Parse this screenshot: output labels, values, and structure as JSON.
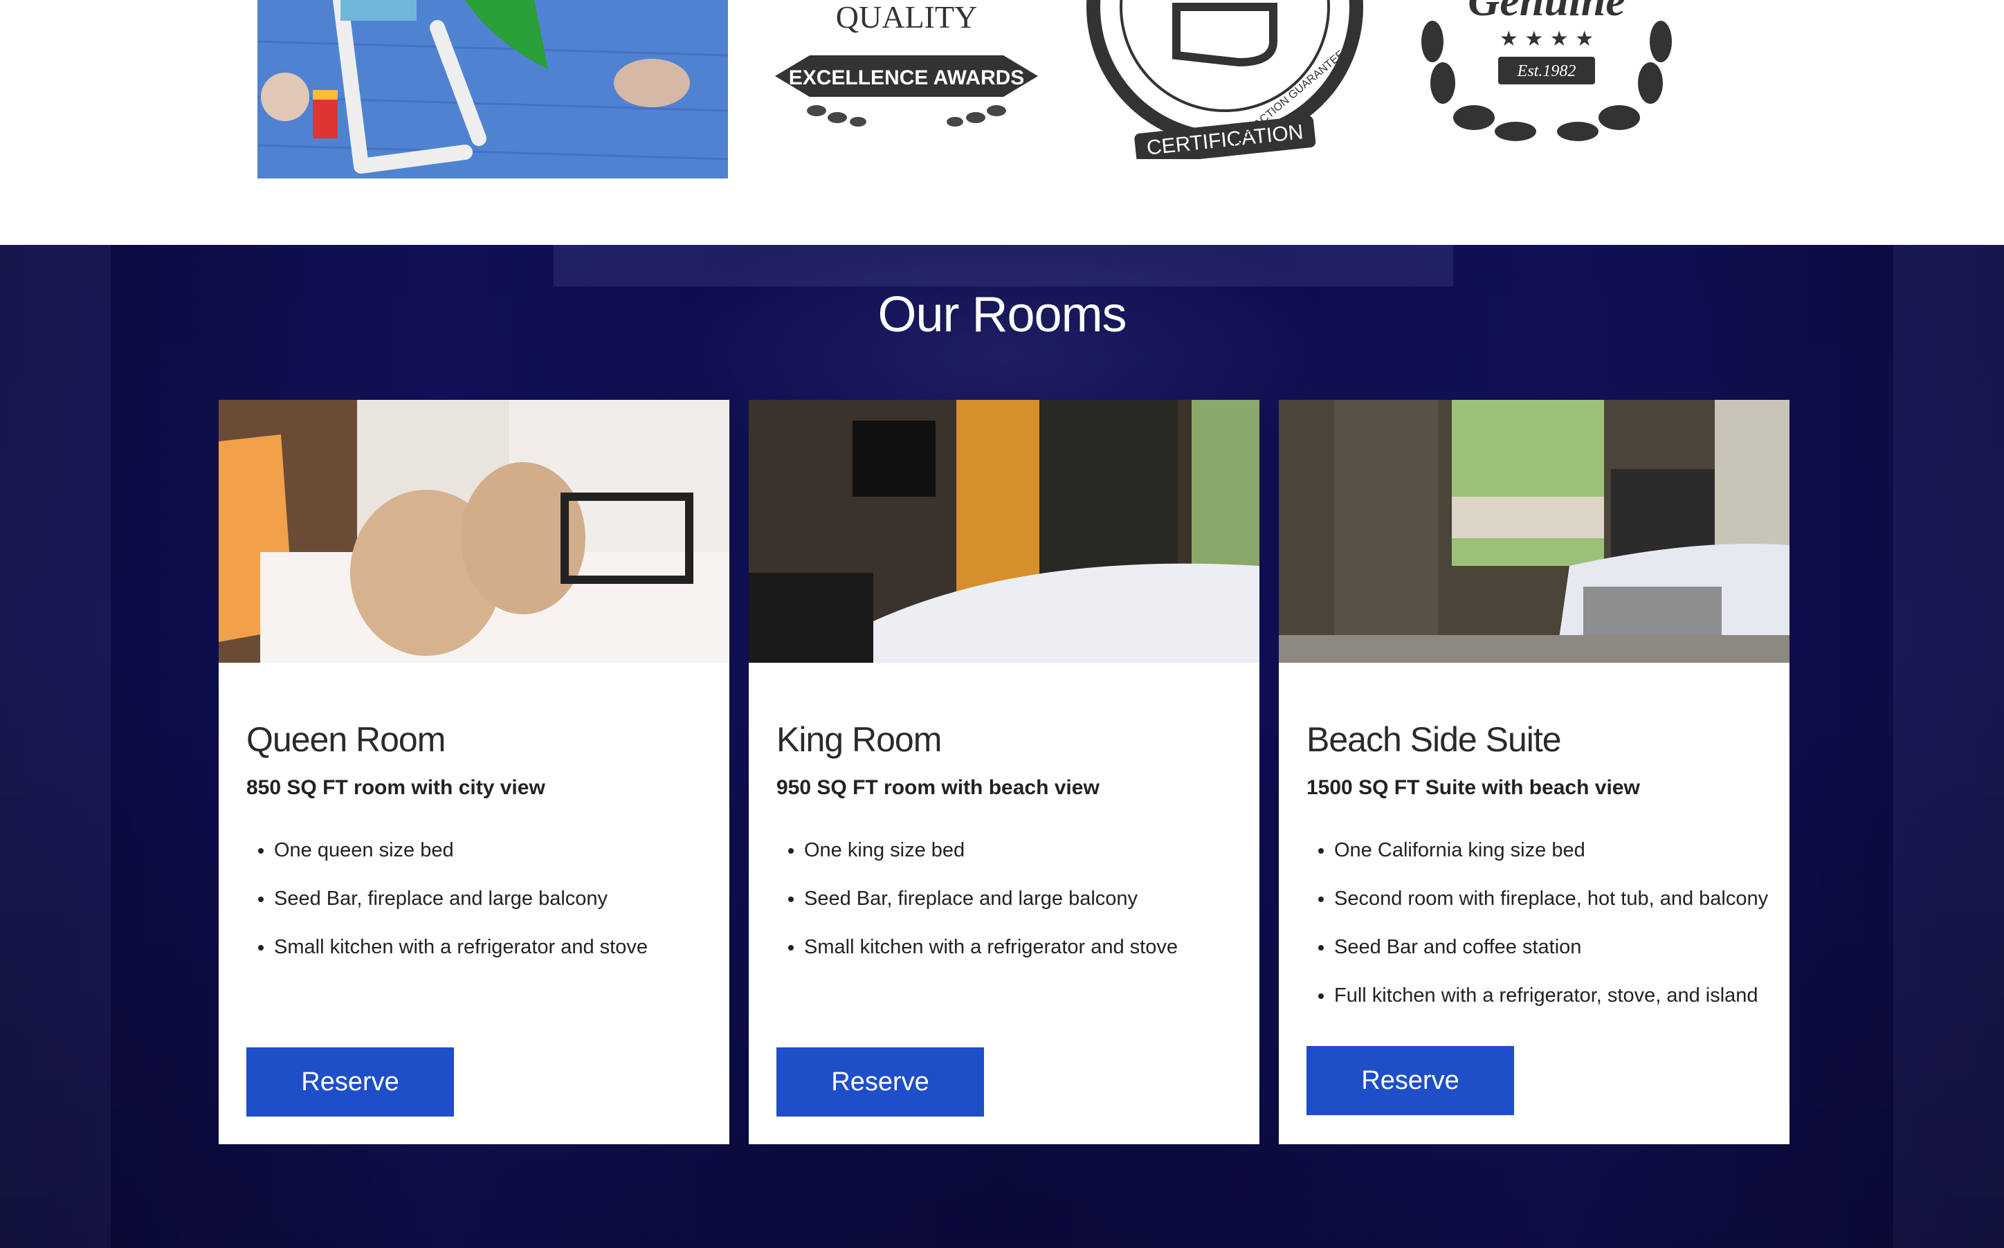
{
  "badges": [
    {
      "top_text": "QUALITY",
      "ribbon_text": "EXCELLENCE AWARDS"
    },
    {
      "arc_text": "SATISFACTION GUARANTEE",
      "ribbon_text": "CERTIFICATION"
    },
    {
      "top_text": "Genuine",
      "ribbon_text": "Est.1982"
    }
  ],
  "rooms_section": {
    "title": "Our Rooms",
    "cards": [
      {
        "name": "Queen Room",
        "subtitle": "850 SQ FT room with city view",
        "features": [
          "One queen size bed",
          "Seed Bar, fireplace and large balcony",
          "Small kitchen with a refrigerator and stove"
        ],
        "button_label": "Reserve"
      },
      {
        "name": "King Room",
        "subtitle": "950 SQ FT room with beach view",
        "features": [
          "One king size bed",
          "Seed Bar, fireplace and large balcony",
          "Small kitchen with a refrigerator and stove"
        ],
        "button_label": "Reserve"
      },
      {
        "name": "Beach Side Suite",
        "subtitle": "1500 SQ FT Suite with beach view",
        "features": [
          "One California king size bed",
          "Second room with fireplace, hot tub, and balcony",
          "Seed Bar and coffee station",
          "Full kitchen with a refrigerator, stove, and island"
        ],
        "button_label": "Reserve"
      }
    ]
  },
  "colors": {
    "button": "#1e4fc9",
    "section_bg": "#12115a",
    "badge": "#333333"
  }
}
